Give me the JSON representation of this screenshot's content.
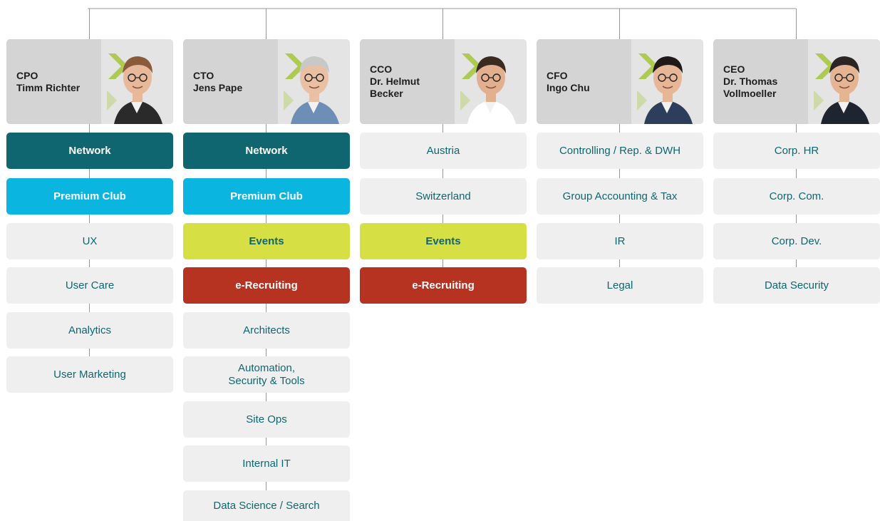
{
  "colors": {
    "network": "#0f6670",
    "premium_club": "#0ab5e0",
    "events": "#d6df44",
    "e_recruiting": "#b63322",
    "plain_box": "#efefef",
    "plain_text": "#0f6670",
    "exec_card": "#d4d4d4",
    "connector": "#9a9a9a",
    "logo_chevron": "#a4c639"
  },
  "executives": [
    {
      "role": "CPO",
      "name_lines": [
        "Timm Richter"
      ],
      "photo": "portrait-photo",
      "departments": [
        {
          "label": "Network",
          "type": "network"
        },
        {
          "label": "Premium Club",
          "type": "premium"
        },
        {
          "label": "UX",
          "type": "plain"
        },
        {
          "label": "User Care",
          "type": "plain"
        },
        {
          "label": "Analytics",
          "type": "plain"
        },
        {
          "label": "User Marketing",
          "type": "plain"
        }
      ]
    },
    {
      "role": "CTO",
      "name_lines": [
        "Jens Pape"
      ],
      "photo": "portrait-photo",
      "departments": [
        {
          "label": "Network",
          "type": "network"
        },
        {
          "label": "Premium Club",
          "type": "premium"
        },
        {
          "label": "Events",
          "type": "events"
        },
        {
          "label": "e-Recruiting",
          "type": "recruit"
        },
        {
          "label": "Architects",
          "type": "plain"
        },
        {
          "label": "Automation,\nSecurity & Tools",
          "type": "plain"
        },
        {
          "label": "Site Ops",
          "type": "plain"
        },
        {
          "label": "Internal IT",
          "type": "plain"
        },
        {
          "label": "Data Science / Search",
          "type": "plain"
        }
      ]
    },
    {
      "role": "CCO",
      "name_lines": [
        "Dr. Helmut",
        "Becker"
      ],
      "photo": "portrait-photo",
      "departments": [
        {
          "label": "Austria",
          "type": "plain"
        },
        {
          "label": "Switzerland",
          "type": "plain"
        },
        {
          "label": "Events",
          "type": "events"
        },
        {
          "label": "e-Recruiting",
          "type": "recruit"
        }
      ]
    },
    {
      "role": "CFO",
      "name_lines": [
        "Ingo Chu"
      ],
      "photo": "portrait-photo",
      "departments": [
        {
          "label": "Controlling / Rep. & DWH",
          "type": "plain"
        },
        {
          "label": "Group Accounting & Tax",
          "type": "plain"
        },
        {
          "label": "IR",
          "type": "plain"
        },
        {
          "label": "Legal",
          "type": "plain"
        }
      ]
    },
    {
      "role": "CEO",
      "name_lines": [
        "Dr. Thomas",
        "Vollmoeller"
      ],
      "photo": "portrait-photo",
      "departments": [
        {
          "label": "Corp. HR",
          "type": "plain"
        },
        {
          "label": "Corp. Com.",
          "type": "plain"
        },
        {
          "label": "Corp. Dev.",
          "type": "plain"
        },
        {
          "label": "Data Security",
          "type": "plain"
        }
      ]
    }
  ]
}
